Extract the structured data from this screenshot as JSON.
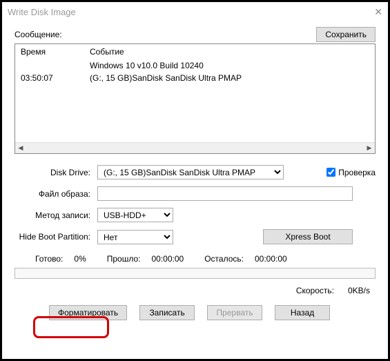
{
  "window": {
    "title": "Write Disk Image"
  },
  "message": {
    "label": "Сообщение:",
    "save_button": "Сохранить"
  },
  "log": {
    "headers": {
      "time": "Время",
      "event": "Событие"
    },
    "rows": [
      {
        "time": "",
        "event": "Windows 10 v10.0 Build 10240"
      },
      {
        "time": "03:50:07",
        "event": "(G:, 15 GB)SanDisk SanDisk Ultra   PMAP"
      }
    ]
  },
  "form": {
    "disk_drive_label": "Disk Drive:",
    "disk_drive_value": "(G:, 15 GB)SanDisk SanDisk Ultra   PMAP",
    "verify_label": "Проверка",
    "verify_checked": true,
    "image_file_label": "Файл образа:",
    "image_file_value": "",
    "write_method_label": "Метод записи:",
    "write_method_value": "USB-HDD+",
    "hide_boot_label": "Hide Boot Partition:",
    "hide_boot_value": "Нет",
    "xpress_boot": "Xpress Boot"
  },
  "status": {
    "ready_label": "Готово:",
    "ready_value": "0%",
    "elapsed_label": "Прошло:",
    "elapsed_value": "00:00:00",
    "remaining_label": "Осталось:",
    "remaining_value": "00:00:00",
    "speed_label": "Скорость:",
    "speed_value": "0KB/s"
  },
  "buttons": {
    "format": "Форматировать",
    "write": "Записать",
    "abort": "Прервать",
    "back": "Назад"
  }
}
